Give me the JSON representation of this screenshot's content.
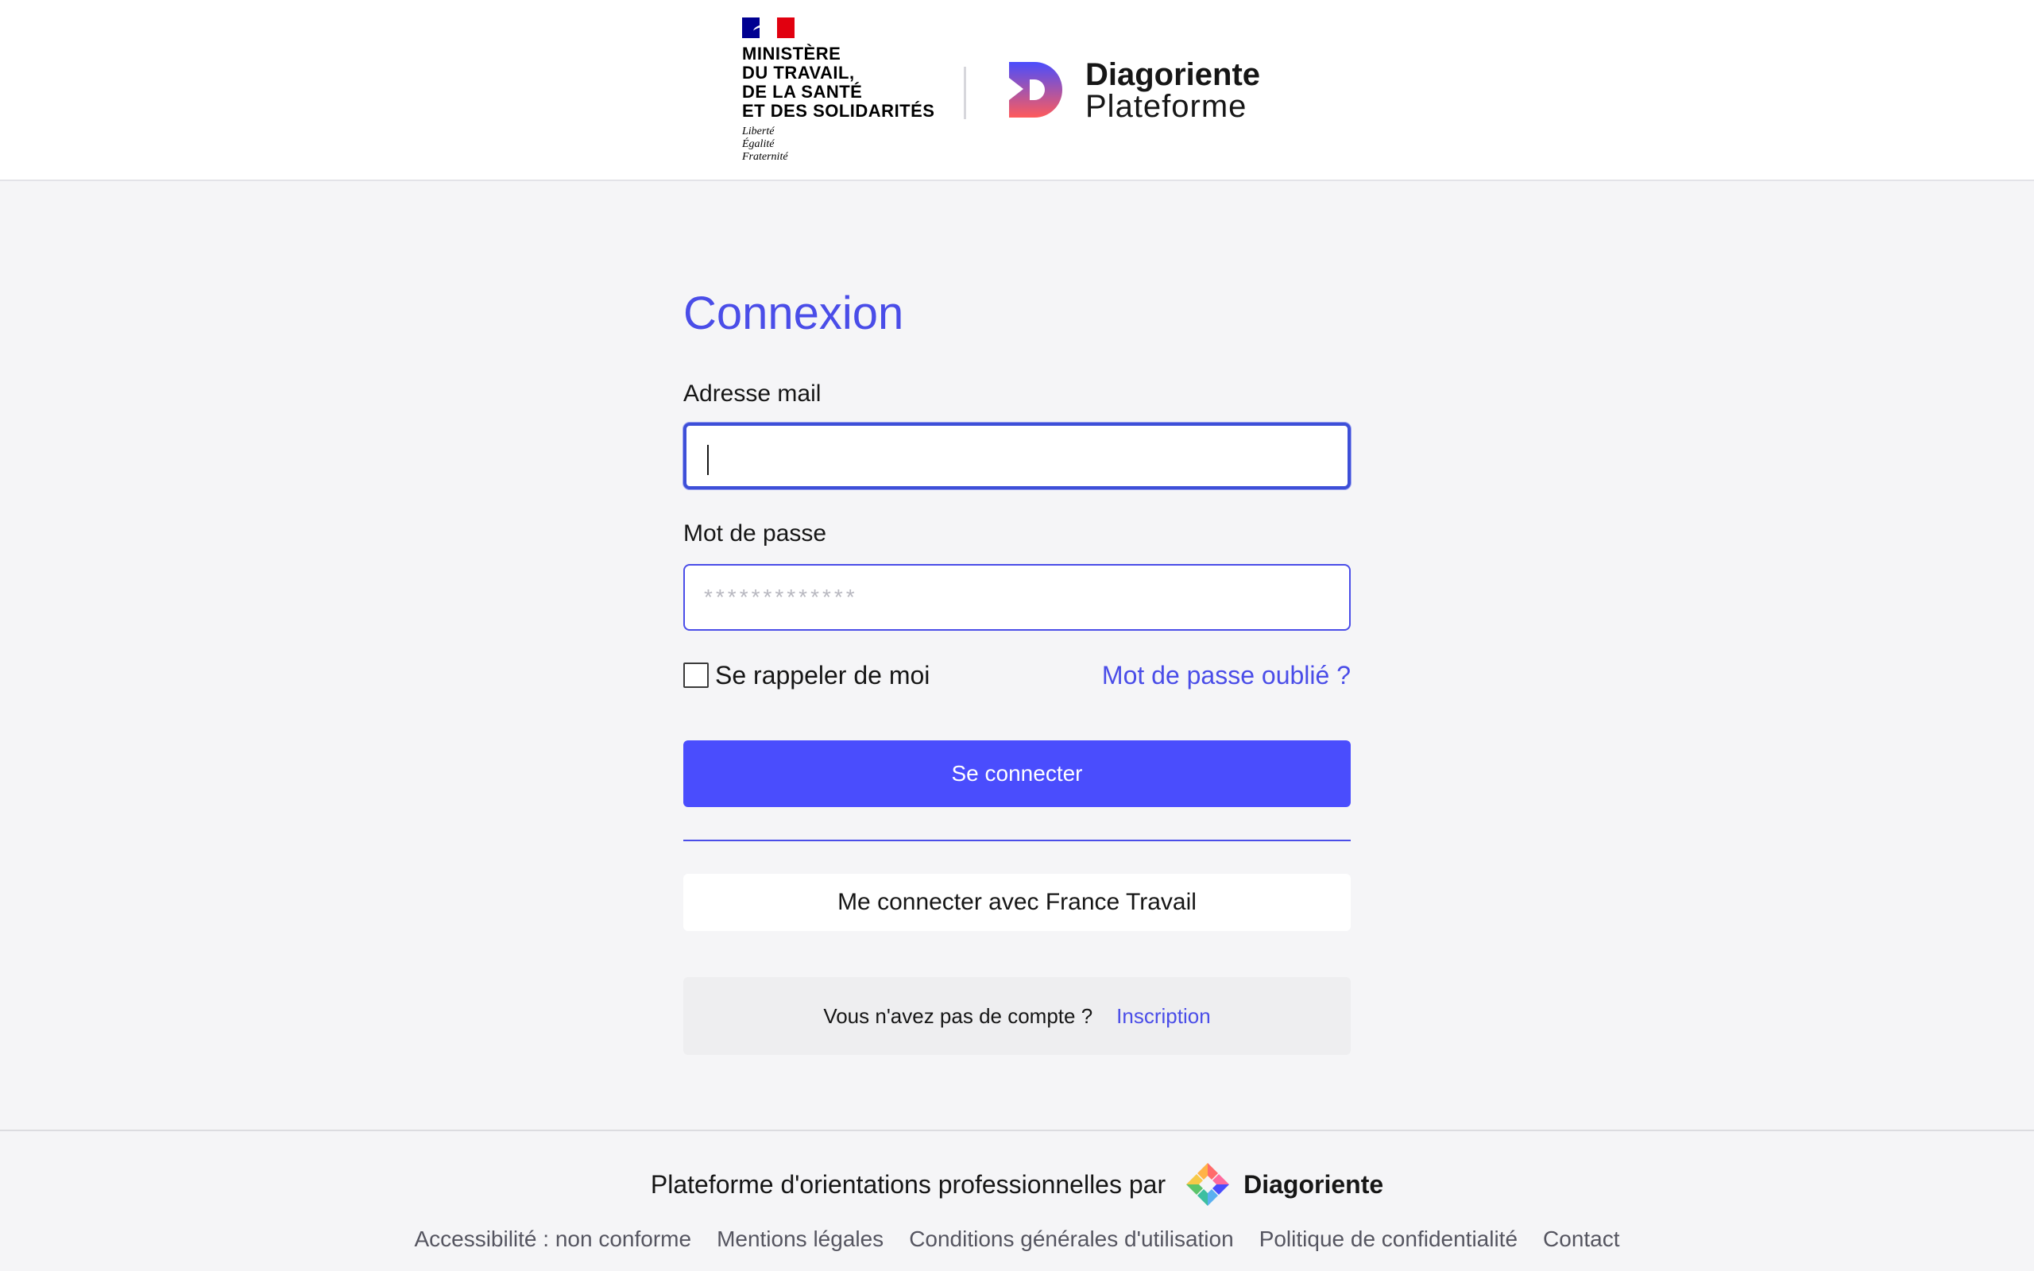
{
  "header": {
    "ministry_lines": [
      "MINISTÈRE",
      "DU TRAVAIL,",
      "DE LA SANTÉ",
      "ET DES SOLIDARITÉS"
    ],
    "motto_lines": [
      "Liberté",
      "Égalité",
      "Fraternité"
    ],
    "brand_name": "Diagoriente",
    "brand_sub": "Plateforme",
    "flag_colors": [
      "#000091",
      "#ffffff",
      "#e1000f"
    ],
    "brand_logo_icon": "diagoriente-d-logo-icon"
  },
  "form": {
    "title": "Connexion",
    "email_label": "Adresse mail",
    "email_value": "",
    "password_label": "Mot de passe",
    "password_placeholder": "*************",
    "remember_label": "Se rappeler de moi",
    "remember_checked": false,
    "forgot_link": "Mot de passe oublié ?",
    "submit_label": "Se connecter",
    "france_travail_label": "Me connecter avec France Travail",
    "no_account_text": "Vous n'avez pas de compte ?",
    "signup_link": "Inscription"
  },
  "footer": {
    "tagline": "Plateforme d'orientations professionnelles par",
    "brand": "Diagoriente",
    "brand_logo_icon": "diagoriente-color-logo-icon",
    "links": [
      "Accessibilité : non conforme",
      "Mentions légales",
      "Conditions générales d'utilisation",
      "Politique de confidentialité",
      "Contact"
    ]
  },
  "colors": {
    "accent": "#4a4de8",
    "primary_button": "#4a4dfd",
    "background": "#f5f5f7"
  }
}
